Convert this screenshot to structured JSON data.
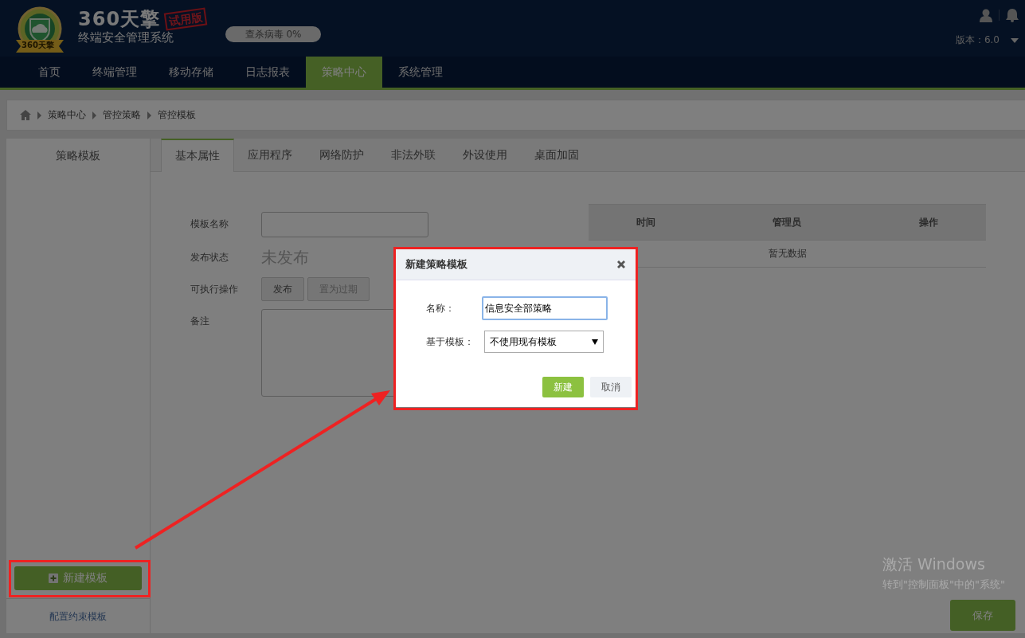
{
  "header": {
    "badge": "360天擎",
    "brand": "360天擎",
    "stamp": "试用版",
    "subtitle": "终端安全管理系统",
    "scan_status": "查杀病毒 0%",
    "version": "版本：6.0"
  },
  "nav": [
    {
      "label": "首页",
      "selected": false
    },
    {
      "label": "终端管理",
      "selected": false
    },
    {
      "label": "移动存储",
      "selected": false
    },
    {
      "label": "日志报表",
      "selected": false
    },
    {
      "label": "策略中心",
      "selected": true
    },
    {
      "label": "系统管理",
      "selected": false
    }
  ],
  "breadcrumb": [
    "策略中心",
    "管控策略",
    "管控模板"
  ],
  "sidebar": {
    "title": "策略模板",
    "new_button": "新建模板",
    "link": "配置约束模板"
  },
  "tabs": [
    {
      "label": "基本属性",
      "selected": true
    },
    {
      "label": "应用程序",
      "selected": false
    },
    {
      "label": "网络防护",
      "selected": false
    },
    {
      "label": "非法外联",
      "selected": false
    },
    {
      "label": "外设使用",
      "selected": false
    },
    {
      "label": "桌面加固",
      "selected": false
    }
  ],
  "form": [
    {
      "kind": "input",
      "label": "模板名称"
    },
    {
      "kind": "status",
      "label": "发布状态",
      "value": "未发布"
    },
    {
      "kind": "buttons",
      "label": "可执行操作",
      "buttons": [
        "发布",
        "置为过期"
      ]
    },
    {
      "kind": "textarea",
      "label": "备注"
    }
  ],
  "history_table": {
    "columns": [
      "时间",
      "管理员",
      "操作"
    ],
    "empty_text": "暂无数据"
  },
  "save_button": "保存",
  "dialog": {
    "title": "新建策略模板",
    "fields": [
      {
        "kind": "input",
        "label": "名称：",
        "value": "信息安全部策略"
      },
      {
        "kind": "select",
        "label": "基于模板：",
        "value": "不使用现有模板"
      }
    ],
    "buttons": [
      {
        "kind": "primary",
        "label": "新建"
      },
      {
        "kind": "secondary",
        "label": "取消"
      }
    ]
  },
  "os_watermark": {
    "title": "激活 Windows",
    "hint": "转到\"控制面板\"中的\"系统\""
  }
}
